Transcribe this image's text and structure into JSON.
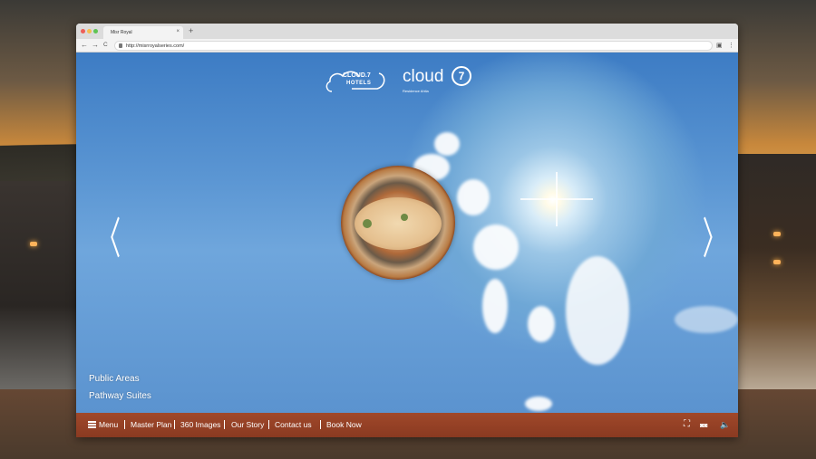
{
  "browser": {
    "tab_title": "Misr Royal",
    "tab_close": "×",
    "new_tab": "+",
    "url": "http://misrroyalseries.com/"
  },
  "nav": {
    "back": "←",
    "forward": "→",
    "reload": "C"
  },
  "logos": {
    "left_line1": "CLOUD.7",
    "left_line2": "HOTELS",
    "right_word": "cloud",
    "right_mark": "7",
    "right_sub": "Residence Ahlia"
  },
  "tour": {
    "prev_arrow": "〈",
    "next_arrow": "〉",
    "area_primary": "Public Areas",
    "area_secondary": "Pathway Suites"
  },
  "menu": {
    "menu_label": "Menu",
    "master_plan": "Master Plan",
    "images_360": "360 Images",
    "our_story": "Our Story",
    "contact_us": "Contact us",
    "book_now": "Book Now"
  },
  "controls": {
    "fullscreen": "⛶",
    "vr": "◙◙",
    "sound": "🔈"
  },
  "colors": {
    "menubar": "#9a4428",
    "sky": "#5b96d3"
  }
}
